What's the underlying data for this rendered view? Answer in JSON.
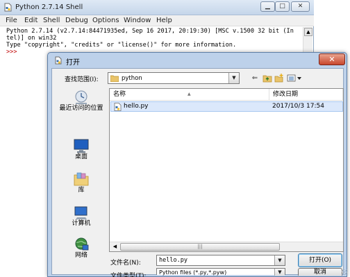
{
  "shell": {
    "title": "Python 2.7.14 Shell",
    "menus": [
      "File",
      "Edit",
      "Shell",
      "Debug",
      "Options",
      "Window",
      "Help"
    ],
    "lines": [
      "Python 2.7.14 (v2.7.14:84471935ed, Sep 16 2017, 20:19:30) [MSC v.1500 32 bit (In",
      "tel)] on win32",
      "Type \"copyright\", \"credits\" or \"license()\" for more information."
    ],
    "prompt": ">>>"
  },
  "dialog": {
    "title": "打开",
    "close_glyph": "✕",
    "look_in_label": "查找范围(I):",
    "look_in_value": "python",
    "places": [
      "最近访问的位置",
      "桌面",
      "库",
      "计算机",
      "网络"
    ],
    "columns": [
      "名称",
      "修改日期"
    ],
    "files": [
      {
        "name": "hello.py",
        "modified": "2017/10/3 17:54"
      }
    ],
    "filename_label": "文件名(N):",
    "filename_value": "hello.py",
    "filetype_label": "文件类型(T):",
    "filetype_value": "Python files (*.py,*.pyw)",
    "open_button": "打开(O)",
    "cancel_button": "取消"
  },
  "icons": {
    "shell_app": "python-file-icon",
    "dialog_app": "python-file-icon",
    "look_in_folder": "folder-icon",
    "back": "back-arrow-icon",
    "up": "up-folder-icon",
    "new_folder": "new-folder-icon",
    "views": "view-menu-icon",
    "places": [
      "recent-places-icon",
      "desktop-icon",
      "libraries-icon",
      "computer-icon",
      "network-icon"
    ],
    "file": "python-file-icon"
  },
  "colors": {
    "selection": "#dbe8fb",
    "close_button": "#c8462d",
    "dialog_frame": "#bdd1ea",
    "prompt": "#c00000"
  }
}
